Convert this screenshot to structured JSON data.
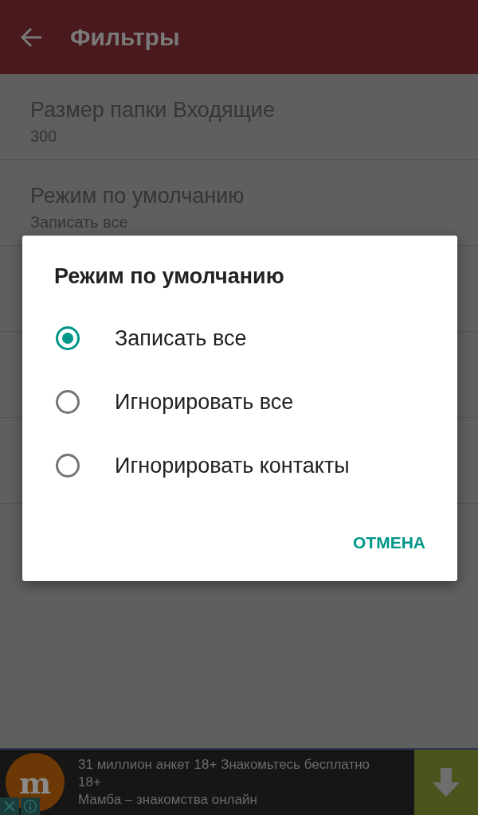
{
  "app_bar": {
    "title": "Фильтры"
  },
  "settings": [
    {
      "title": "Размер папки Входящие",
      "summary": "300"
    },
    {
      "title": "Режим по умолчанию",
      "summary": "Записать все"
    }
  ],
  "dialog": {
    "title": "Режим по умолчанию",
    "options": [
      {
        "label": "Записать все",
        "selected": true
      },
      {
        "label": "Игнорировать все",
        "selected": false
      },
      {
        "label": "Игнорировать контакты",
        "selected": false
      }
    ],
    "button": "ОТМЕНА"
  },
  "ad": {
    "logo_letter": "m",
    "lines": [
      "31 миллион анкет 18+ Знакомьтесь бесплатно",
      "18+",
      "Мамба – знакомства онлайн"
    ]
  }
}
